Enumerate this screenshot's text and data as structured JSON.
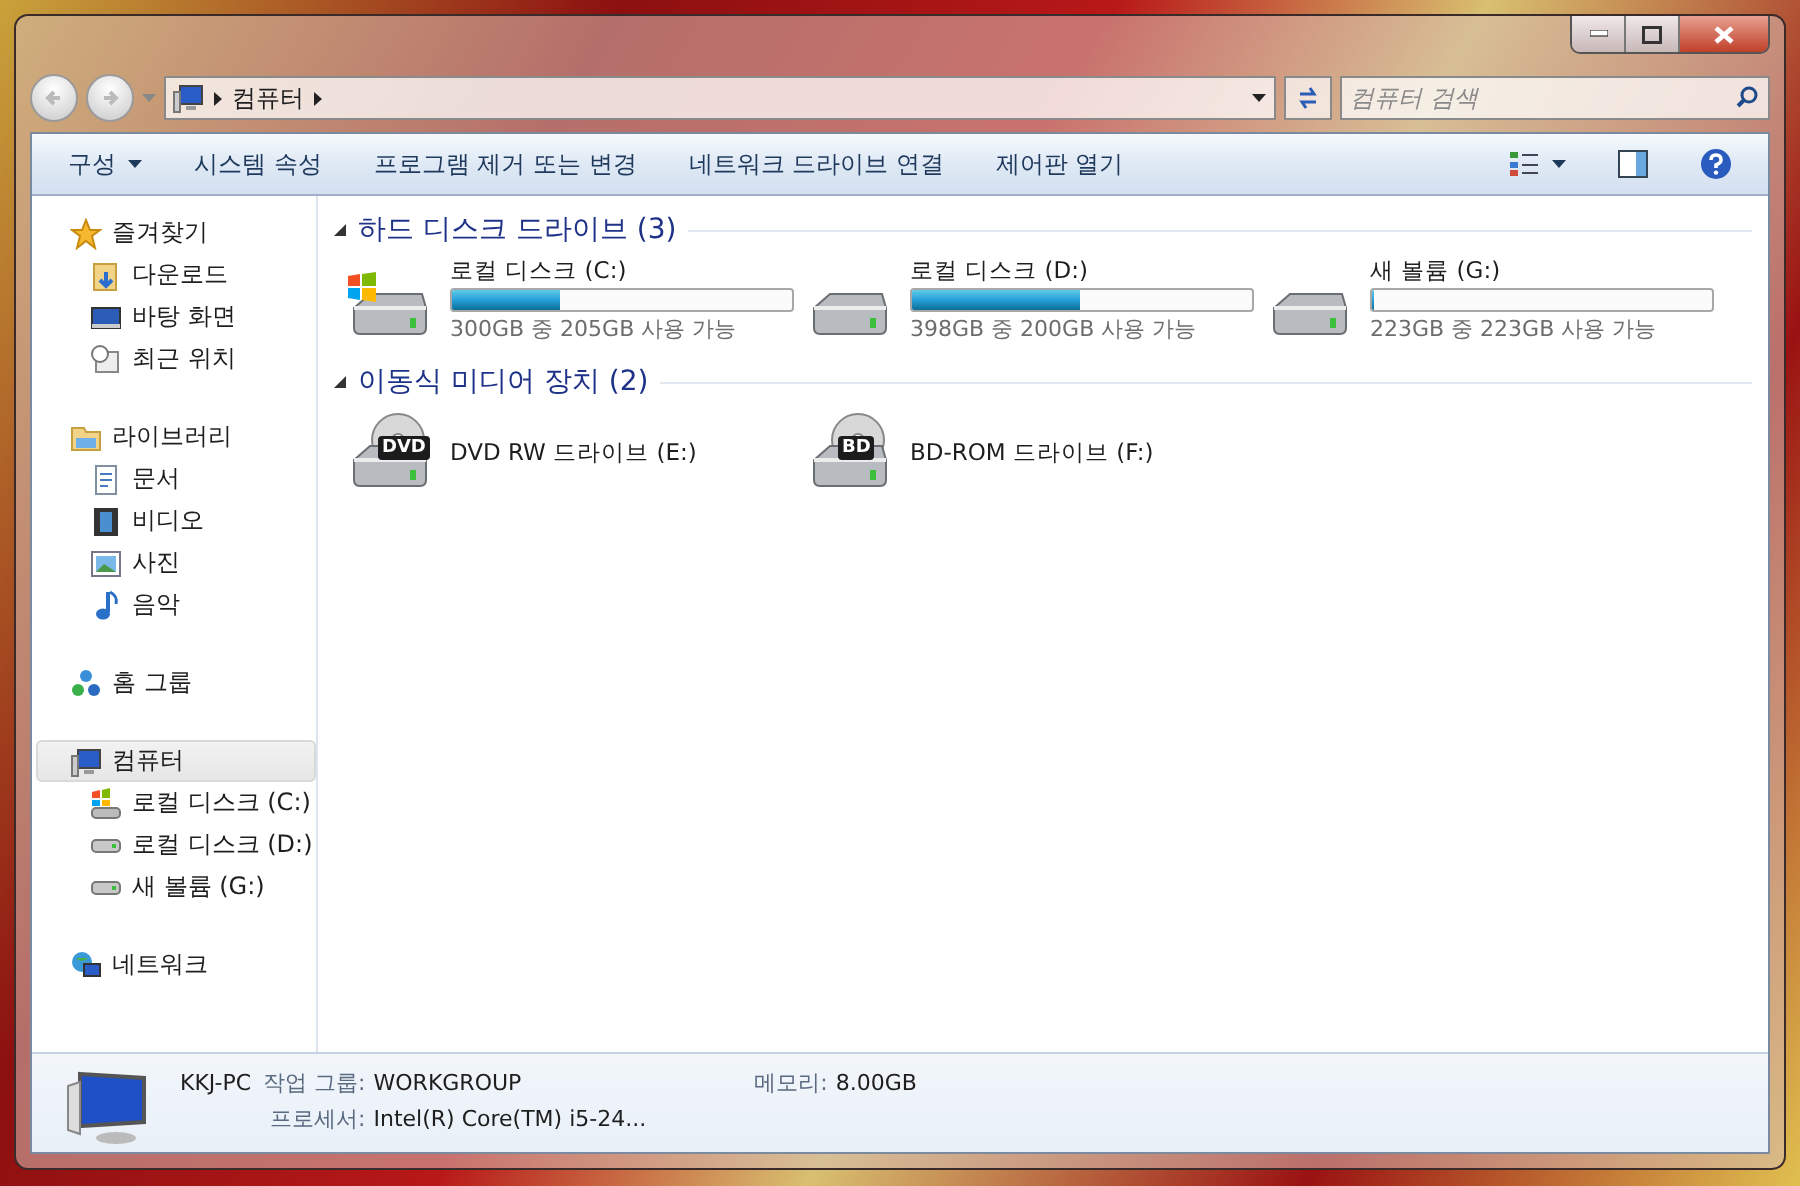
{
  "address_bar": {
    "crumbs": [
      "컴퓨터"
    ]
  },
  "search": {
    "placeholder": "컴퓨터 검색"
  },
  "toolbar": {
    "items": [
      {
        "label": "구성",
        "kind": "menu"
      },
      {
        "label": "시스템 속성",
        "kind": "action"
      },
      {
        "label": "프로그램 제거 또는 변경",
        "kind": "action"
      },
      {
        "label": "네트워크 드라이브 연결",
        "kind": "action"
      },
      {
        "label": "제어판 열기",
        "kind": "action"
      }
    ]
  },
  "sidebar": {
    "groups": [
      {
        "label": "즐겨찾기",
        "kind": "star",
        "selected": false,
        "children": [
          {
            "label": "다운로드",
            "kind": "download",
            "selected": false
          },
          {
            "label": "바탕 화면",
            "kind": "desktop",
            "selected": false
          },
          {
            "label": "최근 위치",
            "kind": "recent",
            "selected": false
          }
        ]
      },
      {
        "label": "라이브러리",
        "kind": "library",
        "selected": false,
        "children": [
          {
            "label": "문서",
            "kind": "document",
            "selected": false
          },
          {
            "label": "비디오",
            "kind": "video",
            "selected": false
          },
          {
            "label": "사진",
            "kind": "picture",
            "selected": false
          },
          {
            "label": "음악",
            "kind": "music",
            "selected": false
          }
        ]
      },
      {
        "label": "홈 그룹",
        "kind": "homegroup",
        "selected": false
      },
      {
        "label": "컴퓨터",
        "kind": "computer",
        "selected": true,
        "children": [
          {
            "label": "로컬 디스크 (C:)",
            "kind": "system",
            "selected": false
          },
          {
            "label": "로컬 디스크 (D:)",
            "kind": "hdd",
            "selected": false
          },
          {
            "label": "새 볼륨 (G:)",
            "kind": "hdd",
            "selected": false
          }
        ]
      },
      {
        "label": "네트워크",
        "kind": "network",
        "selected": false
      }
    ]
  },
  "content": {
    "groups": [
      {
        "title": "하드 디스크 드라이브 (3)",
        "items": [
          {
            "kind": "system",
            "name": "로컬 디스크 (C:)",
            "level": 0.317,
            "free": "300GB 중 205GB 사용 가능"
          },
          {
            "kind": "hdd",
            "name": "로컬 디스크 (D:)",
            "level": 0.497,
            "free": "398GB 중 200GB 사용 가능"
          },
          {
            "kind": "hdd",
            "name": "새 볼륨 (G:)",
            "level": 0,
            "free": "223GB 중 223GB 사용 가능"
          }
        ]
      },
      {
        "title": "이동식 미디어 장치 (2)",
        "items": [
          {
            "kind": "optical",
            "media": "DVD",
            "name": "DVD RW 드라이브 (E:)"
          },
          {
            "kind": "optical",
            "media": "BD",
            "name": "BD-ROM 드라이브 (F:)"
          }
        ]
      }
    ]
  },
  "details": {
    "name": "KKJ-PC",
    "fields": [
      {
        "label": "작업 그룹:",
        "value": "WORKGROUP"
      },
      {
        "label": "메모리:",
        "value": "8.00GB"
      },
      {
        "label": "프로세서:",
        "value": "Intel(R) Core(TM) i5-24..."
      }
    ]
  }
}
